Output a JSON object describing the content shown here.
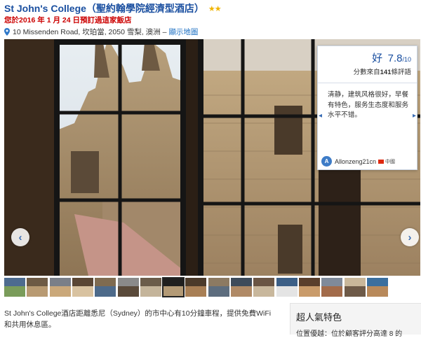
{
  "header": {
    "hotel_name": "St John's College（聖約翰學院經濟型酒店）",
    "stars": "★★",
    "star_count": 2,
    "booked_note": "您於2016 年 1 月 24 日預訂過這家飯店",
    "address": "10 Missenden Road, 坎珀當, 2050 雪梨, 澳洲 –",
    "map_link": "顯示地圖"
  },
  "gallery": {
    "prev_glyph": "‹",
    "next_glyph": "›",
    "selected_thumb_index": 7,
    "thumb_count": 17
  },
  "review": {
    "rating_word": "好",
    "score": "7.8",
    "score_max": "/10",
    "count_prefix": "分數來自",
    "count_number": "141",
    "count_suffix": "條評語",
    "quote": "清静，建筑风格很好，早餐有特色，服务生态度和服务水平不错。",
    "reviewer_initial": "A",
    "reviewer_name": "Allonzeng21cn",
    "reviewer_country": "中國",
    "prev_glyph": "◂",
    "next_glyph": "▸"
  },
  "description": "St John's College酒店距離悉尼（Sydney）的市中心有10分鐘車程，提供免費WiFi和共用休息區。",
  "features": {
    "title": "超人氣特色",
    "first_item": "位置優越：位於顧客評分高達 8 的"
  },
  "colors": {
    "link_blue": "#1a4fa0",
    "booked_red": "#cc0000",
    "star_gold": "#f0b400"
  }
}
